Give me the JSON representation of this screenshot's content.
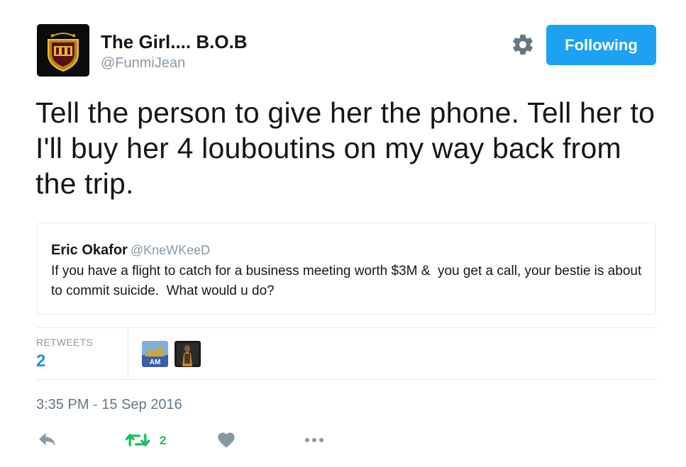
{
  "author": {
    "display_name": "The Girl.... B.O.B",
    "handle": "@FunmiJean"
  },
  "follow_button": {
    "label": "Following",
    "color": "#1da1f2"
  },
  "tweet": {
    "text": "Tell the person to give her the phone. Tell her to I'll buy her 4 louboutins on my way back from the trip."
  },
  "quoted_tweet": {
    "display_name": "Eric Okafor",
    "handle": "@KneWKeeD",
    "text": "If you have a flight to catch for a business meeting worth $3M &  you get a call, your bestie is about to commit suicide.  What would u do?"
  },
  "stats": {
    "retweets_label": "RETWEETS",
    "retweets_count": "2"
  },
  "timestamp": "3:35 PM - 15 Sep 2016",
  "actions": {
    "retweet_count": "2",
    "retweet_color": "#17bf63"
  },
  "icons": [
    "gear-icon",
    "reply-icon",
    "retweet-icon",
    "like-icon",
    "more-icon"
  ]
}
